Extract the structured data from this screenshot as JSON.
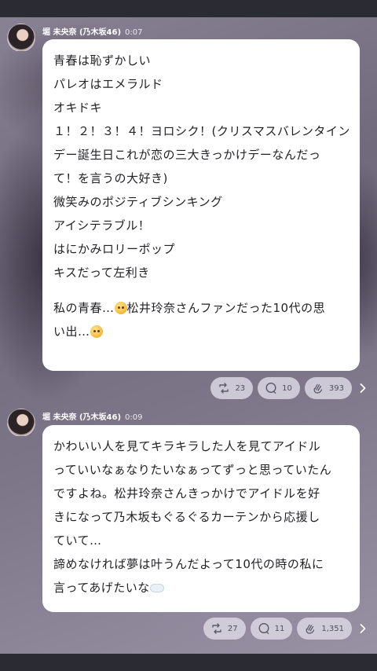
{
  "posts": [
    {
      "author": "堀 未央奈 (乃木坂46)",
      "time": "0:07",
      "lines": [
        "青春は恥ずかしい",
        "パレオはエメラルド",
        "オキドキ",
        "１！２！３！４！ヨロシク！(クリスマスバレンタイン",
        "デー誕生日これが恋の三大きっかけデーなんだっ",
        "て！を言うの大好き)",
        "微笑みのポジティブシンキング",
        "アイシテラブル！",
        "はにかみロリーポップ",
        "キスだって左利き"
      ],
      "closing": {
        "part1": "私の青春…",
        "part2": "松井玲奈さんファンだった10代の思",
        "part3": "い出…"
      },
      "retweets": "23",
      "comments": "10",
      "claps": "393"
    },
    {
      "author": "堀 未央奈 (乃木坂46)",
      "time": "0:09",
      "lines": [
        "かわいい人を見てキラキラした人を見てアイドル",
        "っていいなぁなりたいなぁってずっと思っていたん",
        "ですよね。松井玲奈さんきっかけでアイドルを好",
        "きになって乃木坂もぐるぐるカーテンから応援し",
        "ていて…",
        "諦めなければ夢は叶うんだよって10代の時の私に"
      ],
      "last_line": "言ってあげたいな",
      "retweets": "27",
      "comments": "11",
      "claps": "1,351"
    }
  ],
  "icons": {
    "retweet": "retweet-icon",
    "comment": "comment-icon",
    "clap": "clap-icon",
    "more": "chevron-right-icon",
    "pleading_emoji": "pleading-face-emoji",
    "cloud_emoji": "cloud-emoji"
  },
  "colors": {
    "bubble": "#ffffff",
    "text": "#222226",
    "pill": "#d7d4e0",
    "bar": "#2b2b33"
  }
}
